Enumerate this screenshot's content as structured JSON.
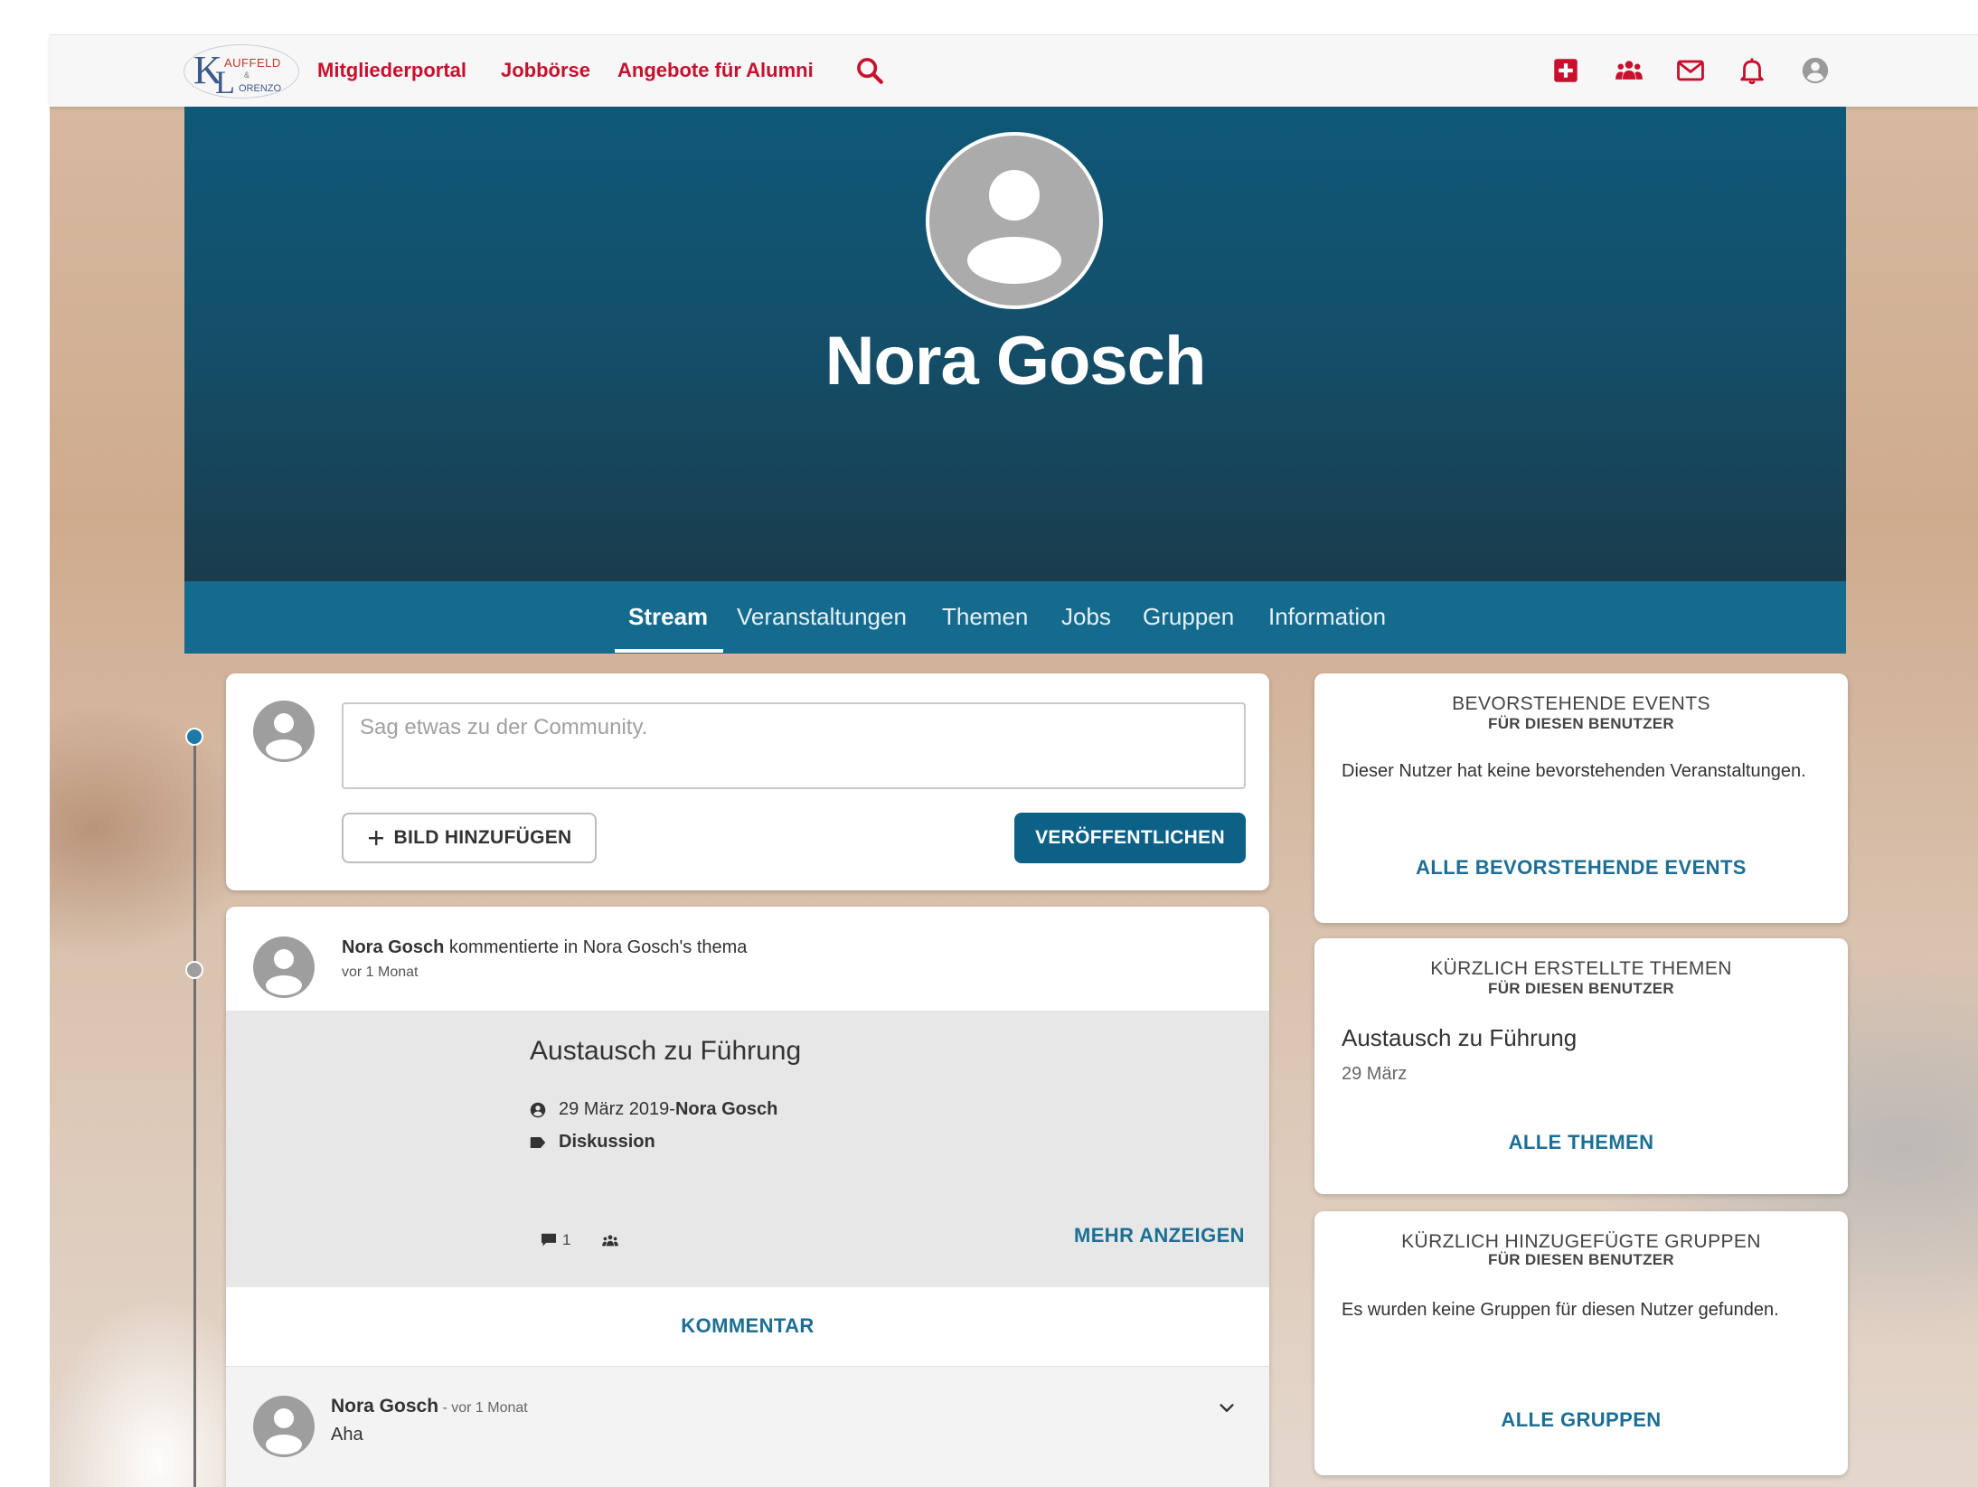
{
  "colors": {
    "brand_red": "#c8102e",
    "teal": "#0d6187",
    "tabbar": "#156b8e"
  },
  "nav": {
    "links": [
      "Mitgliederportal",
      "Jobbörse",
      "Angebote für Alumni"
    ],
    "logo": {
      "line1": "AUFFELD",
      "line2": "&",
      "line3": "ORENZO"
    },
    "icons": [
      "search-icon",
      "plus-square-icon",
      "users-icon",
      "mail-icon",
      "bell-icon",
      "user-circle-icon"
    ]
  },
  "profile": {
    "name": "Nora Gosch"
  },
  "tabs": [
    "Stream",
    "Veranstaltungen",
    "Themen",
    "Jobs",
    "Gruppen",
    "Information"
  ],
  "composer": {
    "placeholder": "Sag etwas zu der Community.",
    "add_image_label": "BILD HINZUFÜGEN",
    "publish_label": "VERÖFFENTLICHEN"
  },
  "activity": {
    "author": "Nora Gosch",
    "action": "kommentierte in Nora Gosch's thema",
    "time": "vor 1 Monat",
    "topic": {
      "title": "Austausch zu Führung",
      "date": "29 März 2019",
      "separator": " - ",
      "author": "Nora Gosch",
      "category": "Diskussion",
      "comment_count": "1",
      "more_label": "MEHR ANZEIGEN"
    },
    "comment_label": "KOMMENTAR",
    "comment": {
      "author": "Nora Gosch",
      "time": " - vor 1 Monat",
      "text": "Aha"
    }
  },
  "sidebar": {
    "events": {
      "title": "BEVORSTEHENDE EVENTS",
      "subtitle": "FÜR DIESEN BENUTZER",
      "text": "Dieser Nutzer hat keine bevorstehenden Veranstaltungen.",
      "link": "ALLE BEVORSTEHENDE EVENTS"
    },
    "topics": {
      "title": "KÜRZLICH ERSTELLTE THEMEN",
      "subtitle": "FÜR DIESEN BENUTZER",
      "item_title": "Austausch zu Führung",
      "item_date": "29 März",
      "link": "ALLE THEMEN"
    },
    "groups": {
      "title": "KÜRZLICH HINZUGEFÜGTE GRUPPEN",
      "subtitle": "FÜR DIESEN BENUTZER",
      "text": "Es wurden keine Gruppen für diesen Nutzer gefunden.",
      "link": "ALLE GRUPPEN"
    }
  }
}
